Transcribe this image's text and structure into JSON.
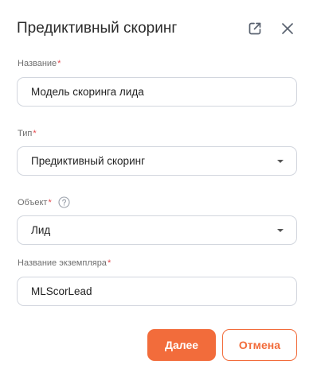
{
  "dialog": {
    "title": "Предиктивный скоринг",
    "icons": {
      "open": "external-link-icon",
      "close": "close-icon"
    }
  },
  "fields": {
    "name": {
      "label": "Название",
      "required_mark": "*",
      "value": "Модель скоринга лида"
    },
    "type": {
      "label": "Тип",
      "required_mark": "*",
      "value": "Предиктивный скоринг"
    },
    "object": {
      "label": "Объект",
      "required_mark": "*",
      "help_icon": "help-circle-icon",
      "value": "Лид"
    },
    "instance_name": {
      "label": "Название экземпляра",
      "required_mark": "*",
      "value": "MLScorLead"
    }
  },
  "actions": {
    "next_label": "Далее",
    "cancel_label": "Отмена"
  },
  "colors": {
    "accent": "#f26c3b",
    "required": "#e5484d",
    "border": "#d2d6de"
  }
}
